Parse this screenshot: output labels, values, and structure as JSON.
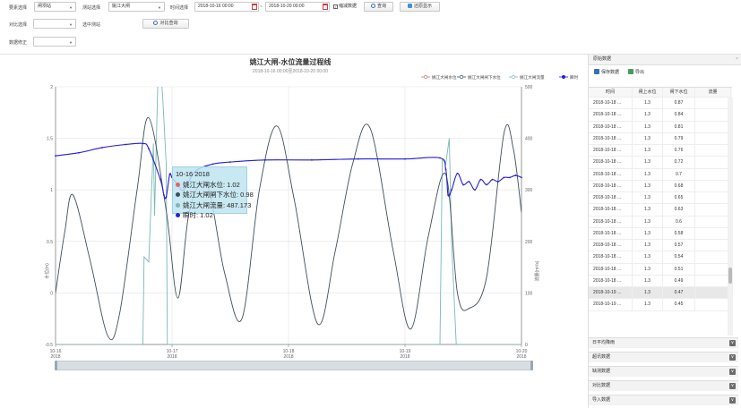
{
  "toolbar": {
    "label_mode": "要素选择",
    "mode_value": "闸坝站",
    "label_station": "测站选择",
    "station_value": "姚江大闸",
    "label_time": "时间选择",
    "time_start": "2018-10-16 00:00",
    "time_sep": "~",
    "time_end": "2018-10-20 00:00",
    "checkbox_label": "缩减数据",
    "checkbox_checked": true,
    "query_button": "查询",
    "reset_button": "还原显示",
    "label_compare": "对比选择",
    "label_selected": "选中测站",
    "compare_button": "对比查询",
    "label_modify": "数据修正"
  },
  "panel": {
    "title": "原始数据",
    "save_button": "保存数据",
    "export_button": "导出",
    "columns": [
      "时间",
      "闸上水位",
      "闸下水位",
      "流量"
    ],
    "rows": [
      [
        "2018-10-18 ...",
        "1.3",
        "0.87",
        ""
      ],
      [
        "2018-10-18 ...",
        "1.3",
        "0.84",
        ""
      ],
      [
        "2018-10-18 ...",
        "1.3",
        "0.81",
        ""
      ],
      [
        "2018-10-18 ...",
        "1.3",
        "0.79",
        ""
      ],
      [
        "2018-10-18 ...",
        "1.3",
        "0.76",
        ""
      ],
      [
        "2018-10-18 ...",
        "1.3",
        "0.72",
        ""
      ],
      [
        "2018-10-18 ...",
        "1.3",
        "0.7",
        ""
      ],
      [
        "2018-10-18 ...",
        "1.3",
        "0.68",
        ""
      ],
      [
        "2018-10-18 ...",
        "1.3",
        "0.65",
        ""
      ],
      [
        "2018-10-18 ...",
        "1.3",
        "0.63",
        ""
      ],
      [
        "2018-10-18 ...",
        "1.3",
        "0.6",
        ""
      ],
      [
        "2018-10-18 ...",
        "1.3",
        "0.58",
        ""
      ],
      [
        "2018-10-18 ...",
        "1.3",
        "0.57",
        ""
      ],
      [
        "2018-10-18 ...",
        "1.3",
        "0.54",
        ""
      ],
      [
        "2018-10-18 ...",
        "1.3",
        "0.51",
        ""
      ],
      [
        "2018-10-18 ...",
        "1.3",
        "0.49",
        ""
      ],
      [
        "2018-10-19 ...",
        "1.3",
        "0.47",
        ""
      ],
      [
        "2018-10-19 ...",
        "1.3",
        "0.45",
        ""
      ]
    ],
    "selected_row": 16,
    "sections": [
      "日平均降雨",
      "超讯数据",
      "缺测数据",
      "对比数据",
      "导入数据"
    ],
    "toggle_label": "∨"
  },
  "tooltip": {
    "time": "10-16 2018",
    "items": [
      {
        "label": "姚江大闸水位: 1.02",
        "color": "#e06666"
      },
      {
        "label": "姚江大闸闸下水位: 0.98",
        "color": "#3d4f5c"
      },
      {
        "label": "姚江大闸流量: 487.173",
        "color": "#7ab8b6"
      },
      {
        "label": "瞬时: 1.02",
        "color": "#2222dd"
      }
    ]
  },
  "chart_data": {
    "type": "line",
    "title": "姚江大闸-水位流量过程线",
    "subtitle": "2018-10-16 00:00至2018-10-20 00:00",
    "ylabel_left": "水位(m)",
    "ylabel_right": "流量(m³/s)",
    "xlim": [
      0,
      4
    ],
    "ylim_left": [
      -0.5,
      2
    ],
    "ylim_right": [
      0,
      500
    ],
    "y_ticks_left": [
      "-0.5",
      "0",
      "0.5",
      "1",
      "1.5",
      "2"
    ],
    "y_ticks_right": [
      "0",
      "100",
      "200",
      "300",
      "400",
      "500"
    ],
    "x_ticks": [
      {
        "x": 0,
        "line1": "10-16",
        "line2": "2018"
      },
      {
        "x": 1,
        "line1": "10-17",
        "line2": "2018"
      },
      {
        "x": 2,
        "line1": "10-18",
        "line2": "2018"
      },
      {
        "x": 3,
        "line1": "10-19",
        "line2": "2018"
      },
      {
        "x": 4,
        "line1": "10-20",
        "line2": "2018"
      }
    ],
    "grid": true,
    "legend_position": "top-right",
    "series": [
      {
        "name": "姚江大闸水位",
        "color": "#e06666",
        "axis": "left",
        "x": [
          0,
          0.2,
          0.4,
          0.6,
          0.75,
          0.8,
          0.9,
          0.93,
          0.95,
          0.98,
          1.0,
          1.05,
          1.1,
          1.2,
          1.35,
          1.5,
          1.8,
          2.2,
          2.6,
          3.0,
          3.3,
          3.35,
          3.37,
          3.4,
          3.45,
          3.5,
          3.55,
          3.6,
          3.65,
          3.7,
          3.75,
          3.8,
          3.85,
          3.9,
          3.95,
          4.0
        ],
        "y": [
          1.33,
          1.36,
          1.41,
          1.44,
          1.45,
          1.4,
          1.1,
          0.95,
          0.93,
          1.15,
          1.12,
          1.05,
          1.0,
          1.18,
          1.25,
          1.27,
          1.29,
          1.29,
          1.3,
          1.3,
          1.31,
          1.2,
          0.95,
          1.0,
          1.16,
          1.05,
          1.08,
          1.0,
          1.1,
          1.05,
          1.1,
          1.08,
          1.12,
          1.12,
          1.14,
          1.12
        ]
      },
      {
        "name": "姚江大闸闸下水位",
        "color": "#3d4f5c",
        "axis": "left",
        "x": [
          0,
          0.08,
          0.15,
          0.3,
          0.45,
          0.55,
          0.7,
          0.8,
          0.95,
          1.05,
          1.15,
          1.3,
          1.45,
          1.6,
          1.75,
          1.9,
          2.05,
          2.25,
          2.4,
          2.55,
          2.7,
          2.9,
          3.05,
          3.2,
          3.35,
          3.45,
          3.55,
          3.7,
          3.85,
          3.93,
          4.0
        ],
        "y": [
          0.0,
          0.6,
          0.95,
          0.3,
          -0.42,
          -0.2,
          1.0,
          1.7,
          0.8,
          -0.05,
          0.8,
          1.05,
          0.2,
          -0.25,
          1.0,
          1.62,
          0.9,
          -0.3,
          0.4,
          1.25,
          1.6,
          0.4,
          -0.35,
          0.55,
          1.15,
          0.0,
          -0.15,
          0.15,
          1.55,
          1.4,
          0.78
        ]
      },
      {
        "name": "姚江大闸流量",
        "color": "#7ab8b6",
        "axis": "right",
        "x": [
          0,
          0.75,
          0.76,
          0.8,
          0.84,
          0.85,
          0.88,
          0.9,
          0.92,
          0.95,
          0.96,
          3.3,
          3.32,
          3.35,
          3.38,
          3.4,
          3.42,
          3.44,
          3.45,
          4.0
        ],
        "y": [
          0,
          0,
          170,
          160,
          390,
          250,
          530,
          540,
          480,
          350,
          0,
          0,
          360,
          350,
          400,
          200,
          100,
          0,
          0,
          0
        ]
      },
      {
        "name": "瞬时",
        "color": "#2222dd",
        "axis": "left",
        "x": [
          0,
          0.2,
          0.4,
          0.6,
          0.75,
          0.8,
          0.9,
          0.93,
          0.95,
          0.98,
          1.0,
          1.05,
          1.1,
          1.2,
          1.35,
          1.5,
          1.8,
          2.2,
          2.6,
          3.0,
          3.3,
          3.35,
          3.37,
          3.4,
          3.45,
          3.5,
          3.55,
          3.6,
          3.65,
          3.7,
          3.75,
          3.8,
          3.85,
          3.9,
          3.95,
          4.0
        ],
        "y": [
          1.33,
          1.36,
          1.41,
          1.44,
          1.45,
          1.4,
          1.1,
          0.95,
          0.93,
          1.15,
          1.12,
          1.05,
          1.0,
          1.18,
          1.25,
          1.27,
          1.29,
          1.29,
          1.3,
          1.3,
          1.31,
          1.2,
          0.95,
          1.0,
          1.16,
          1.05,
          1.08,
          1.0,
          1.1,
          1.05,
          1.1,
          1.08,
          1.12,
          1.12,
          1.14,
          1.12
        ]
      }
    ]
  }
}
